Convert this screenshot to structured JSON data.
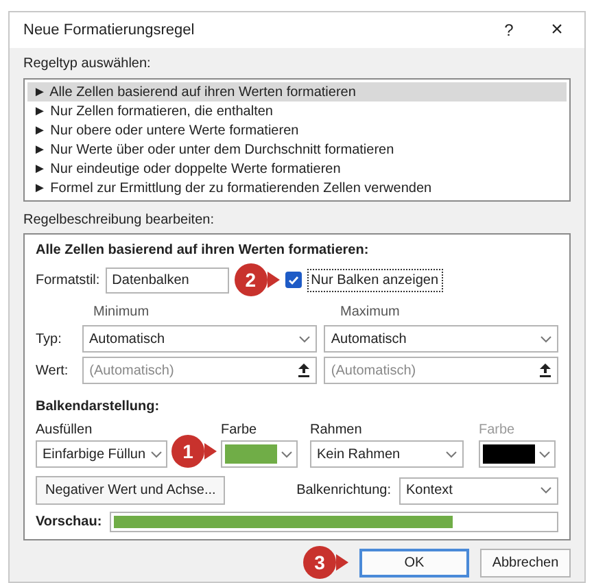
{
  "window": {
    "title": "Neue Formatierungsregel",
    "help": "?",
    "close": "×"
  },
  "rule_type": {
    "label": "Regeltyp auswählen:",
    "items": [
      {
        "text": "► Alle Zellen basierend auf ihren Werten formatieren",
        "selected": true
      },
      {
        "text": "► Nur Zellen formatieren, die enthalten",
        "selected": false
      },
      {
        "text": "► Nur obere oder untere Werte formatieren",
        "selected": false
      },
      {
        "text": "► Nur Werte über oder unter dem Durchschnitt formatieren",
        "selected": false
      },
      {
        "text": "► Nur eindeutige oder doppelte Werte formatieren",
        "selected": false
      },
      {
        "text": "► Formel zur Ermittlung der zu formatierenden Zellen verwenden",
        "selected": false
      }
    ]
  },
  "rule_description": {
    "label": "Regelbeschreibung bearbeiten:",
    "heading": "Alle Zellen basierend auf ihren Werten formatieren:",
    "format_style": {
      "label": "Formatstil:",
      "value": "Datenbalken"
    },
    "bars_only": {
      "label": "Nur Balken anzeigen",
      "checked": true
    },
    "min_label": "Minimum",
    "max_label": "Maximum",
    "type": {
      "label": "Typ:",
      "min": "Automatisch",
      "max": "Automatisch"
    },
    "value": {
      "label": "Wert:",
      "min_placeholder": "(Automatisch)",
      "max_placeholder": "(Automatisch)"
    },
    "bar_appearance": {
      "heading": "Balkendarstellung:",
      "fill": {
        "label": "Ausfüllen",
        "value": "Einfarbige Füllun"
      },
      "fill_color": {
        "label": "Farbe",
        "color": "#70ad47"
      },
      "border": {
        "label": "Rahmen",
        "value": "Kein Rahmen"
      },
      "border_color": {
        "label": "Farbe",
        "color": "#000000",
        "disabled": true
      }
    },
    "negative_button": "Negativer Wert und Achse...",
    "direction": {
      "label": "Balkenrichtung:",
      "value": "Kontext"
    },
    "preview": {
      "label": "Vorschau:",
      "level": 0.77,
      "color": "#70ad47"
    }
  },
  "buttons": [
    {
      "label": "OK",
      "default": true
    },
    {
      "label": "Abbrechen",
      "default": false
    }
  ],
  "callouts": [
    {
      "number": "1"
    },
    {
      "number": "2"
    },
    {
      "number": "3"
    }
  ]
}
